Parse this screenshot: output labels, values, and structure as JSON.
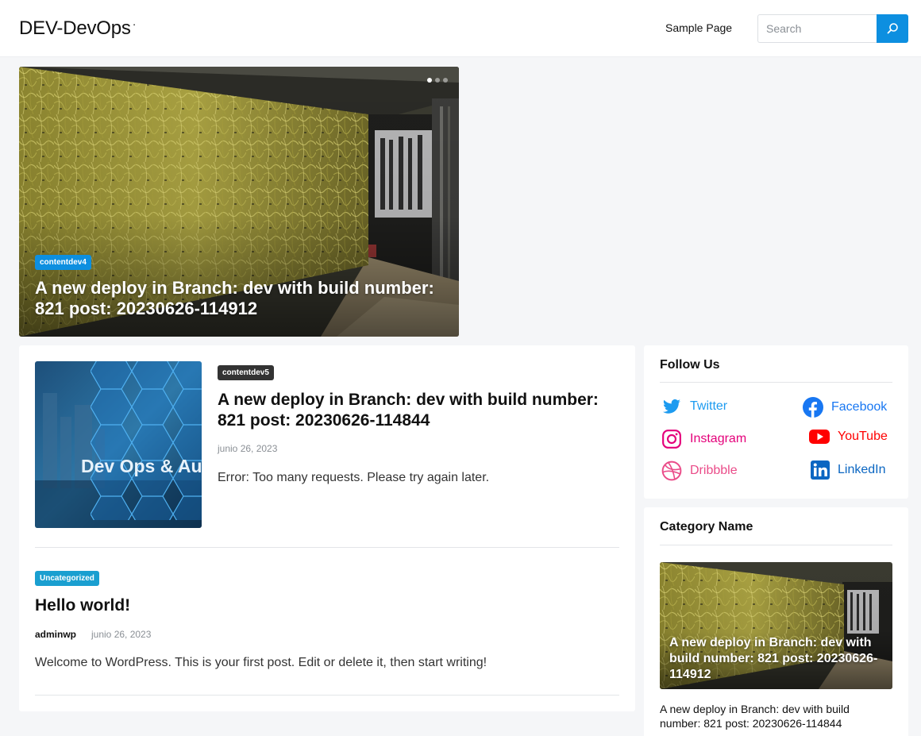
{
  "header": {
    "site_title": "DEV-DevOps",
    "site_title_suffix": "·",
    "nav": [
      "Sample Page"
    ],
    "search": {
      "placeholder": "Search"
    },
    "accent_color": "#0d8fe0"
  },
  "hero": {
    "badge": "contentdev4",
    "title": "A new deploy in Branch: dev with build number: 821 post: 20230626-114912",
    "slider_dots": 3,
    "active_dot": 0
  },
  "posts": [
    {
      "badge": "contentdev5",
      "title": "A new deploy in Branch: dev with build number: 821 post: 20230626-114844",
      "date": "junio 26, 2023",
      "excerpt": "Error: Too many requests. Please try again later.",
      "thumb_text": "Dev Ops & Au"
    },
    {
      "badge": "Uncategorized",
      "title": "Hello world!",
      "author": "adminwp",
      "date": "junio 26, 2023",
      "excerpt": "Welcome to WordPress. This is your first post. Edit or delete it, then start writing!"
    }
  ],
  "sidebar": {
    "follow": {
      "title": "Follow Us",
      "items": [
        {
          "label": "Twitter",
          "icon": "twitter-icon",
          "color": "#1d9bf0"
        },
        {
          "label": "Facebook",
          "icon": "facebook-icon",
          "color": "#1877f2"
        },
        {
          "label": "Instagram",
          "icon": "instagram-icon",
          "color": "#e4007a"
        },
        {
          "label": "YouTube",
          "icon": "youtube-icon",
          "color": "#ff0000"
        },
        {
          "label": "Dribbble",
          "icon": "dribbble-icon",
          "color": "#ea4c89"
        },
        {
          "label": "LinkedIn",
          "icon": "linkedin-icon",
          "color": "#0a66c2"
        }
      ]
    },
    "category": {
      "title": "Category Name",
      "thumb_title": "A new deploy in Branch: dev with build number: 821 post: 20230626-114912",
      "caption": "A new deploy in Branch: dev with build number: 821 post: 20230626-114844"
    }
  }
}
